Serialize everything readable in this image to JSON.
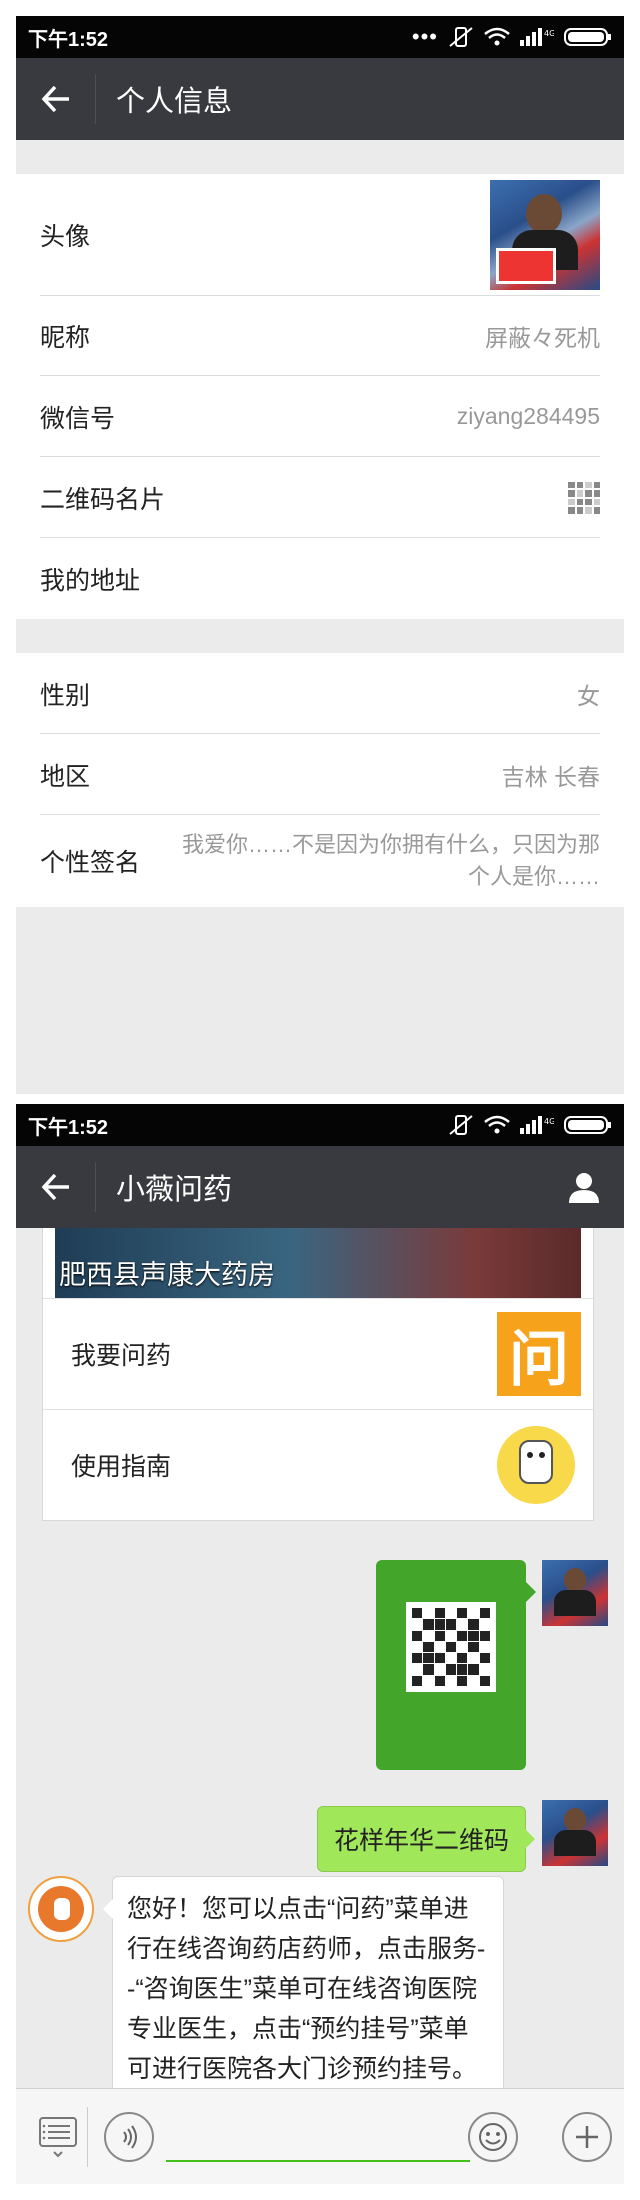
{
  "screen1": {
    "status": {
      "time": "下午1:52"
    },
    "title": "个人信息",
    "profile": {
      "avatar_label": "头像",
      "nickname_label": "昵称",
      "nickname_value": "屏蔽々死机",
      "wechat_id_label": "微信号",
      "wechat_id_value": "ziyang284495",
      "qr_label": "二维码名片",
      "address_label": "我的地址"
    },
    "details": {
      "gender_label": "性别",
      "gender_value": "女",
      "region_label": "地区",
      "region_value": "吉林 长春",
      "signature_label": "个性签名",
      "signature_value": "我爱你……不是因为你拥有什么，只因为那个人是你……"
    }
  },
  "screen2": {
    "status": {
      "time": "下午1:52"
    },
    "title": "小薇问药",
    "menu": {
      "banner_text": "肥西县声康大药房",
      "banner_neon": "",
      "item1": "我要问药",
      "item1_icon_char": "问",
      "item2": "使用指南"
    },
    "qr_card": {
      "header": "",
      "footer": "",
      "footer_small": ""
    },
    "messages": {
      "sent_text": "花样年华二维码",
      "reply_text": "您好！您可以点击“问药”菜单进行在线咨询药店药师，点击服务--“咨询医生”菜单可在线咨询医院专业医生，点击“预约挂号”菜单可进行医院各大门诊预约挂号。谢谢！祝您健康快乐！"
    },
    "input": {
      "placeholder": ""
    }
  },
  "colors": {
    "title_bar": "#393a3f",
    "status_bar": "#050505",
    "accent_green": "#45c01a",
    "bubble_green": "#a0e75a",
    "wen_orange": "#f7a21b"
  }
}
